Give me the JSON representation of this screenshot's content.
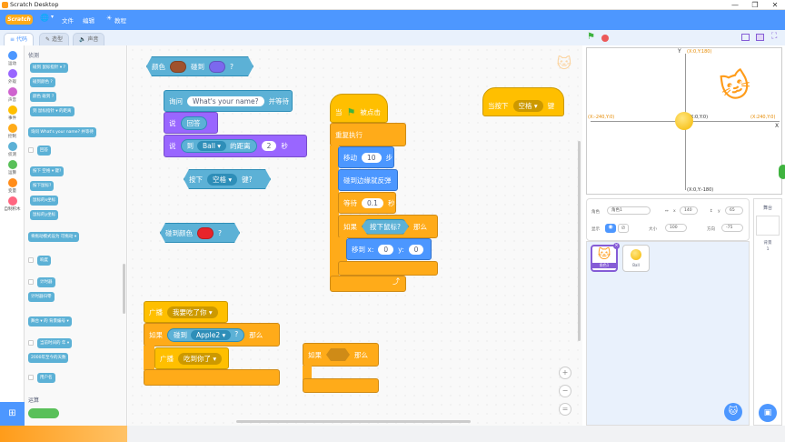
{
  "window": {
    "title": "Scratch Desktop",
    "controls": [
      "—",
      "❐",
      "✕"
    ]
  },
  "menubar": {
    "logo": "Scratch",
    "items": [
      "文件",
      "编辑",
      "教程"
    ],
    "globe": "🌐"
  },
  "tabs": [
    {
      "label": "代码"
    },
    {
      "label": "造型"
    },
    {
      "label": "声音"
    }
  ],
  "categories": [
    {
      "label": "运动",
      "color": "#4c97ff"
    },
    {
      "label": "外观",
      "color": "#9966ff"
    },
    {
      "label": "声音",
      "color": "#cf63cf"
    },
    {
      "label": "事件",
      "color": "#ffbf00"
    },
    {
      "label": "控制",
      "color": "#ffab19"
    },
    {
      "label": "侦测",
      "color": "#5cb1d6"
    },
    {
      "label": "运算",
      "color": "#59c059"
    },
    {
      "label": "变量",
      "color": "#ff8c1a"
    },
    {
      "label": "自制积木",
      "color": "#ff6680"
    }
  ],
  "palette": {
    "section_sensing": "侦测",
    "section_operators": "运算",
    "blocks": [
      "碰到 鼠标指针 ▾ ?",
      "碰到颜色 ?",
      "颜色 碰到 ?",
      "到 鼠标指针 ▾ 的距离",
      "询问 What's your name? 并等待",
      "回答",
      "按下 空格 ▾ 键?",
      "按下鼠标?",
      "鼠标的x坐标",
      "鼠标的y坐标",
      "将拖动模式设为 可拖动 ▾",
      "响度",
      "计时器",
      "计时器归零",
      "舞台 ▾ 的 背景编号 ▾",
      "当前时间的 年 ▾",
      "2000年至今的天数",
      "用户名"
    ]
  },
  "workspace": {
    "b_touch_color": {
      "t1": "颜色",
      "t2": "碰到",
      "t3": "?",
      "c1": "#a0522d",
      "c2": "#7b68ee"
    },
    "b_ask": {
      "t1": "询问",
      "input": "What's your name?",
      "t2": "并等待"
    },
    "b_say1": {
      "t1": "说",
      "input": "回答"
    },
    "b_say2": {
      "t1": "说",
      "t2": "到",
      "dd": "Ball",
      "t3": "的距离",
      "num": "2",
      "t4": "秒"
    },
    "b_key": {
      "t1": "按下",
      "dd": "空格",
      "t2": "键?"
    },
    "b_touchcolor2": {
      "t1": "碰到颜色",
      "t2": "?",
      "c": "#e8242a"
    },
    "b_broadcast1": {
      "t1": "广播",
      "dd": "我要吃了你"
    },
    "b_if1": {
      "t1": "如果",
      "t2": "碰到",
      "dd": "Apple2",
      "t3": "?",
      "t4": "那么"
    },
    "b_broadcast2": {
      "t1": "广播",
      "dd": "吃到你了"
    },
    "b_flag": {
      "t1": "当",
      "t2": "被点击"
    },
    "b_forever": {
      "t1": "重复执行"
    },
    "b_move": {
      "t1": "移动",
      "num": "10",
      "t2": "步"
    },
    "b_bounce": {
      "t1": "碰到边缘就反弹"
    },
    "b_wait": {
      "t1": "等待",
      "num": "0.1",
      "t2": "秒"
    },
    "b_if2": {
      "t1": "如果",
      "t2": "按下鼠标?",
      "t3": "那么"
    },
    "b_goto": {
      "t1": "移到 x:",
      "x": "0",
      "t2": "y:",
      "y": "0"
    },
    "b_whenkey": {
      "t1": "当按下",
      "dd": "空格",
      "t2": "键"
    },
    "b_if3": {
      "t1": "如果",
      "t2": "那么"
    }
  },
  "zoom": {
    "in": "+",
    "out": "−",
    "reset": "="
  },
  "stage": {
    "labels": {
      "top": "(X:0,Y:180)",
      "bottom": "(X:0,Y:-180)",
      "left": "(X:-240,Y:0)",
      "right": "(X:240,Y:0)",
      "center": "(X:0,Y:0)",
      "yaxis": "Y",
      "xaxis": "X"
    }
  },
  "sprite_info": {
    "sprite_label": "角色",
    "sprite_name": "角色1",
    "x_label": "x",
    "x": "140",
    "y_label": "y",
    "y": "65",
    "show_label": "显示",
    "size_label": "大小",
    "size": "100",
    "dir_label": "方向",
    "dir": "-75"
  },
  "sprites": [
    {
      "name": "角色1"
    },
    {
      "name": "Ball"
    }
  ],
  "stage_panel": {
    "title": "舞台",
    "backdrop_label": "背景",
    "backdrop_count": "1"
  }
}
